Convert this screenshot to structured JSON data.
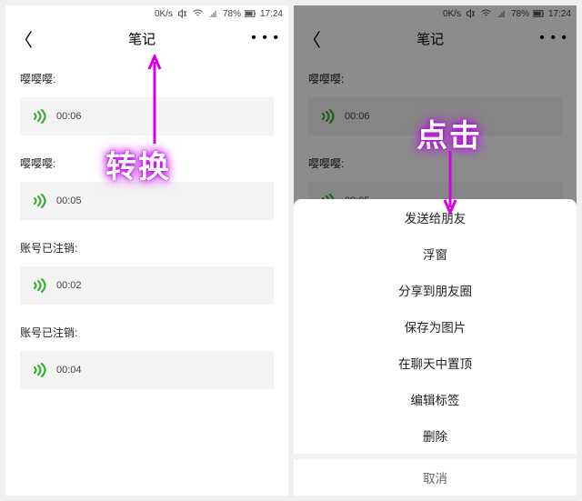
{
  "status": {
    "speed": "0K/s",
    "battery": "78%",
    "time": "17:24"
  },
  "header": {
    "title": "笔记"
  },
  "left": {
    "items": [
      {
        "sender": "嘤嘤嘤:",
        "dur": "00:06"
      },
      {
        "sender": "嘤嘤嘤:",
        "dur": "00:05"
      },
      {
        "sender": "账号已注销:",
        "dur": "00:02"
      },
      {
        "sender": "账号已注销:",
        "dur": "00:04"
      }
    ],
    "overlay": "转换"
  },
  "right": {
    "items": [
      {
        "sender": "嘤嘤嘤:",
        "dur": "00:06"
      },
      {
        "sender": "嘤嘤嘤:",
        "dur": "00:05"
      }
    ],
    "menu": [
      "发送给朋友",
      "浮窗",
      "分享到朋友圈",
      "保存为图片",
      "在聊天中置顶",
      "编辑标签",
      "删除"
    ],
    "cancel": "取消",
    "overlay": "点击"
  }
}
